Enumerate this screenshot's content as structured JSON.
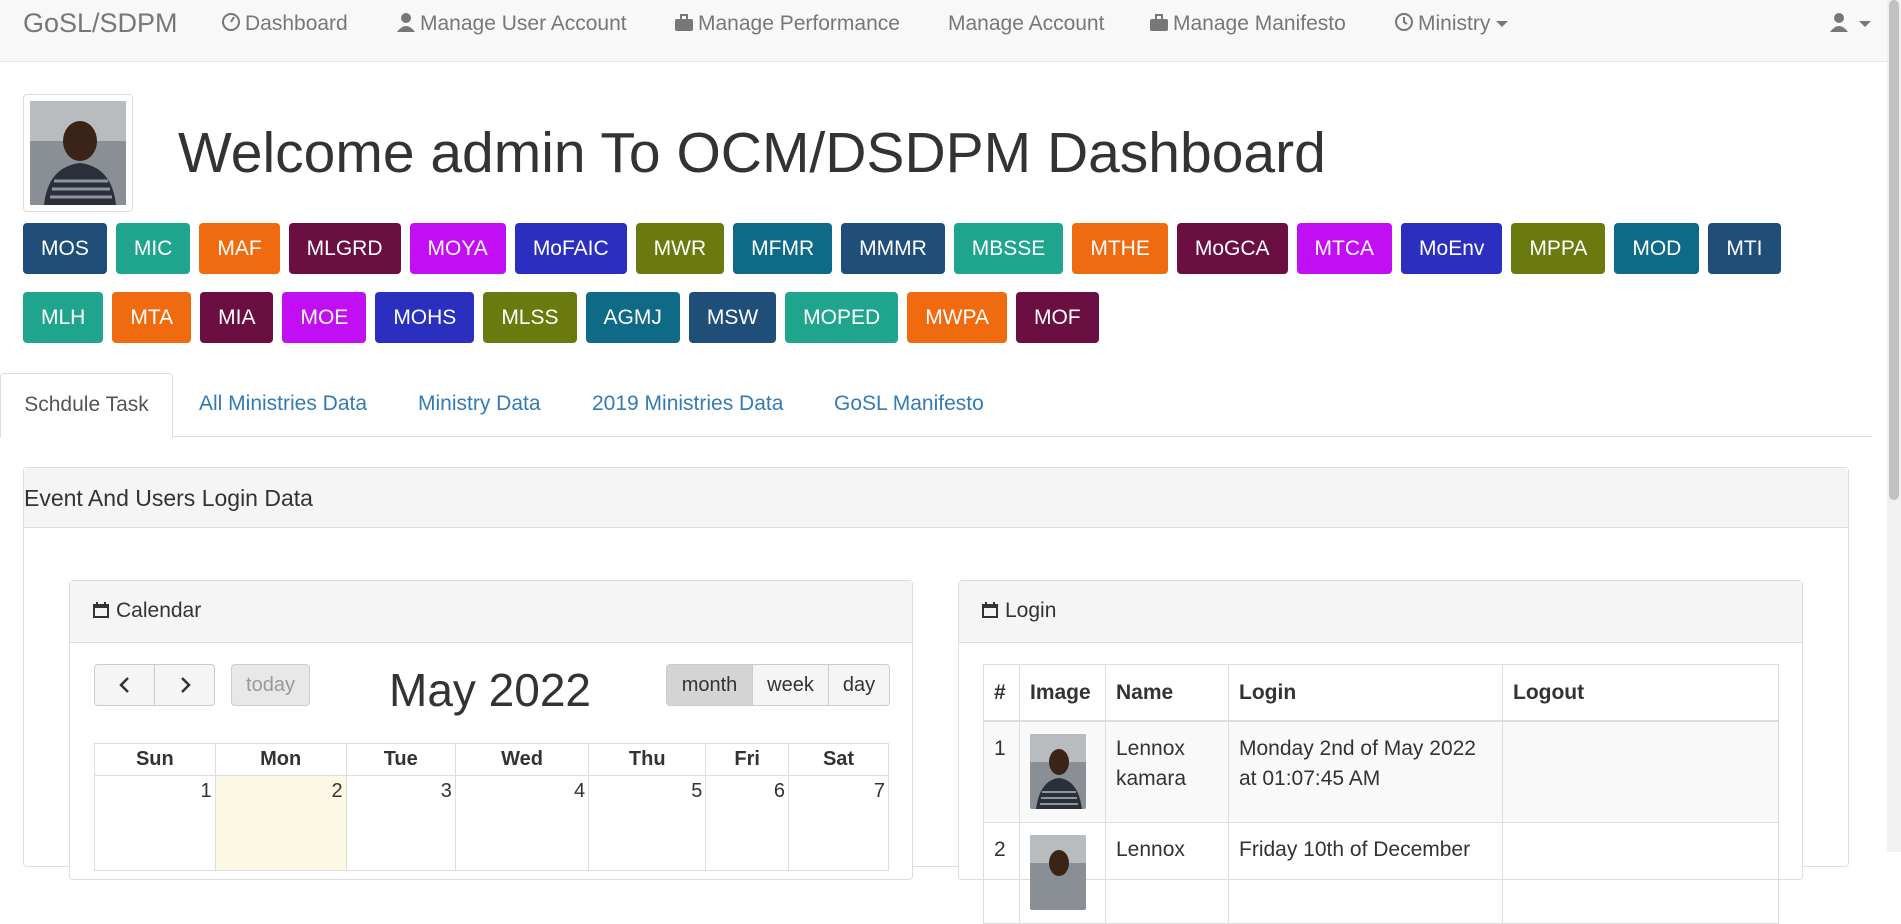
{
  "navbar": {
    "brand": "GoSL/SDPM",
    "items": [
      {
        "label": "Dashboard",
        "icon": "dashboard-icon"
      },
      {
        "label": "Manage User Account",
        "icon": "user-icon"
      },
      {
        "label": "Manage Performance",
        "icon": "briefcase-icon"
      },
      {
        "label": "Manage Account",
        "icon": ""
      },
      {
        "label": "Manage Manifesto",
        "icon": "briefcase-icon"
      },
      {
        "label": "Ministry",
        "icon": "clock-icon"
      }
    ]
  },
  "header": {
    "welcome": "Welcome admin To OCM/DSDPM Dashboard"
  },
  "ministries": {
    "row1": [
      {
        "label": "MOS",
        "color": "#1f4e79"
      },
      {
        "label": "MIC",
        "color": "#1fa58e"
      },
      {
        "label": "MAF",
        "color": "#f06b10"
      },
      {
        "label": "MLGRD",
        "color": "#6b0f43"
      },
      {
        "label": "MOYA",
        "color": "#c20ef2"
      },
      {
        "label": "MoFAIC",
        "color": "#2a2fbf"
      },
      {
        "label": "MWR",
        "color": "#6b7a0f"
      },
      {
        "label": "MFMR",
        "color": "#0f6a87"
      },
      {
        "label": "MMMR",
        "color": "#1f4e79"
      },
      {
        "label": "MBSSE",
        "color": "#1fa58e"
      },
      {
        "label": "MTHE",
        "color": "#f06b10"
      },
      {
        "label": "MoGCA",
        "color": "#6b0f43"
      },
      {
        "label": "MTCA",
        "color": "#c20ef2"
      },
      {
        "label": "MoEnv",
        "color": "#2a2fbf"
      },
      {
        "label": "MPPA",
        "color": "#6b7a0f"
      },
      {
        "label": "MOD",
        "color": "#0f6a87"
      },
      {
        "label": "MTI",
        "color": "#1f4e79"
      }
    ],
    "row2": [
      {
        "label": "MLH",
        "color": "#1fa58e"
      },
      {
        "label": "MTA",
        "color": "#f06b10"
      },
      {
        "label": "MIA",
        "color": "#6b0f43"
      },
      {
        "label": "MOE",
        "color": "#c20ef2"
      },
      {
        "label": "MOHS",
        "color": "#2a2fbf"
      },
      {
        "label": "MLSS",
        "color": "#6b7a0f"
      },
      {
        "label": "AGMJ",
        "color": "#0f6a87"
      },
      {
        "label": "MSW",
        "color": "#1f4e79"
      },
      {
        "label": "MOPED",
        "color": "#1fa58e"
      },
      {
        "label": "MWPA",
        "color": "#f06b10"
      },
      {
        "label": "MOF",
        "color": "#6b0f43"
      }
    ]
  },
  "tabs": [
    "Schdule Task",
    "All Ministries Data",
    "Ministry Data",
    "2019 Ministries Data",
    "GoSL Manifesto"
  ],
  "panel": {
    "title": "Event And Users Login Data"
  },
  "calendar": {
    "heading": "Calendar",
    "title": "May 2022",
    "today_label": "today",
    "views": [
      "month",
      "week",
      "day"
    ],
    "days": [
      "Sun",
      "Mon",
      "Tue",
      "Wed",
      "Thu",
      "Fri",
      "Sat"
    ],
    "week1": [
      "1",
      "2",
      "3",
      "4",
      "5",
      "6",
      "7"
    ]
  },
  "login": {
    "heading": "Login",
    "columns": [
      "#",
      "Image",
      "Name",
      "Login",
      "Logout"
    ],
    "rows": [
      {
        "num": "1",
        "name": "Lennox kamara",
        "login": "Monday 2nd of May 2022 at 01:07:45 AM",
        "logout": ""
      },
      {
        "num": "2",
        "name": "Lennox",
        "login": "Friday 10th of December",
        "logout": ""
      }
    ]
  }
}
